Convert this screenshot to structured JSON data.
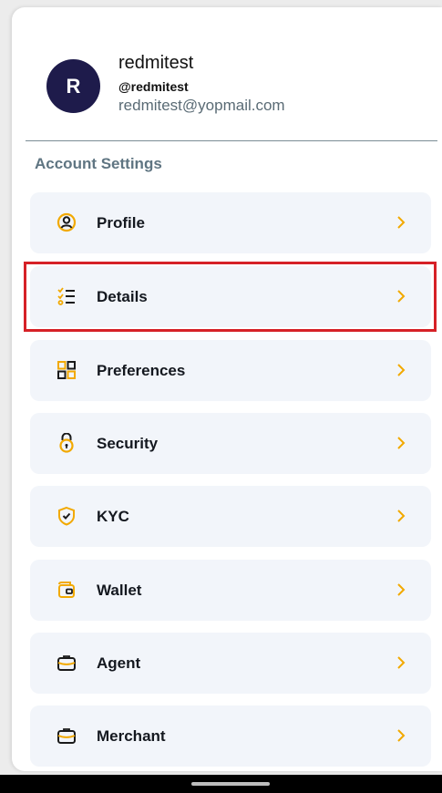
{
  "profile": {
    "avatar_initial": "R",
    "name": "redmitest",
    "handle": "@redmitest",
    "email": "redmitest@yopmail.com"
  },
  "section": {
    "title": "Account Settings"
  },
  "menu": {
    "items": [
      {
        "label": "Profile",
        "icon": "user-circle-icon"
      },
      {
        "label": "Details",
        "icon": "checklist-icon"
      },
      {
        "label": "Preferences",
        "icon": "grid-icon"
      },
      {
        "label": "Security",
        "icon": "lock-icon"
      },
      {
        "label": "KYC",
        "icon": "shield-check-icon"
      },
      {
        "label": "Wallet",
        "icon": "wallet-icon"
      },
      {
        "label": "Agent",
        "icon": "briefcase-icon"
      },
      {
        "label": "Merchant",
        "icon": "briefcase-icon"
      }
    ]
  },
  "colors": {
    "accent": "#f2a900",
    "avatar_bg": "#1e1b4b",
    "highlight": "#d62127",
    "card_bg": "#f2f5fa",
    "muted_text": "#5f7582"
  }
}
